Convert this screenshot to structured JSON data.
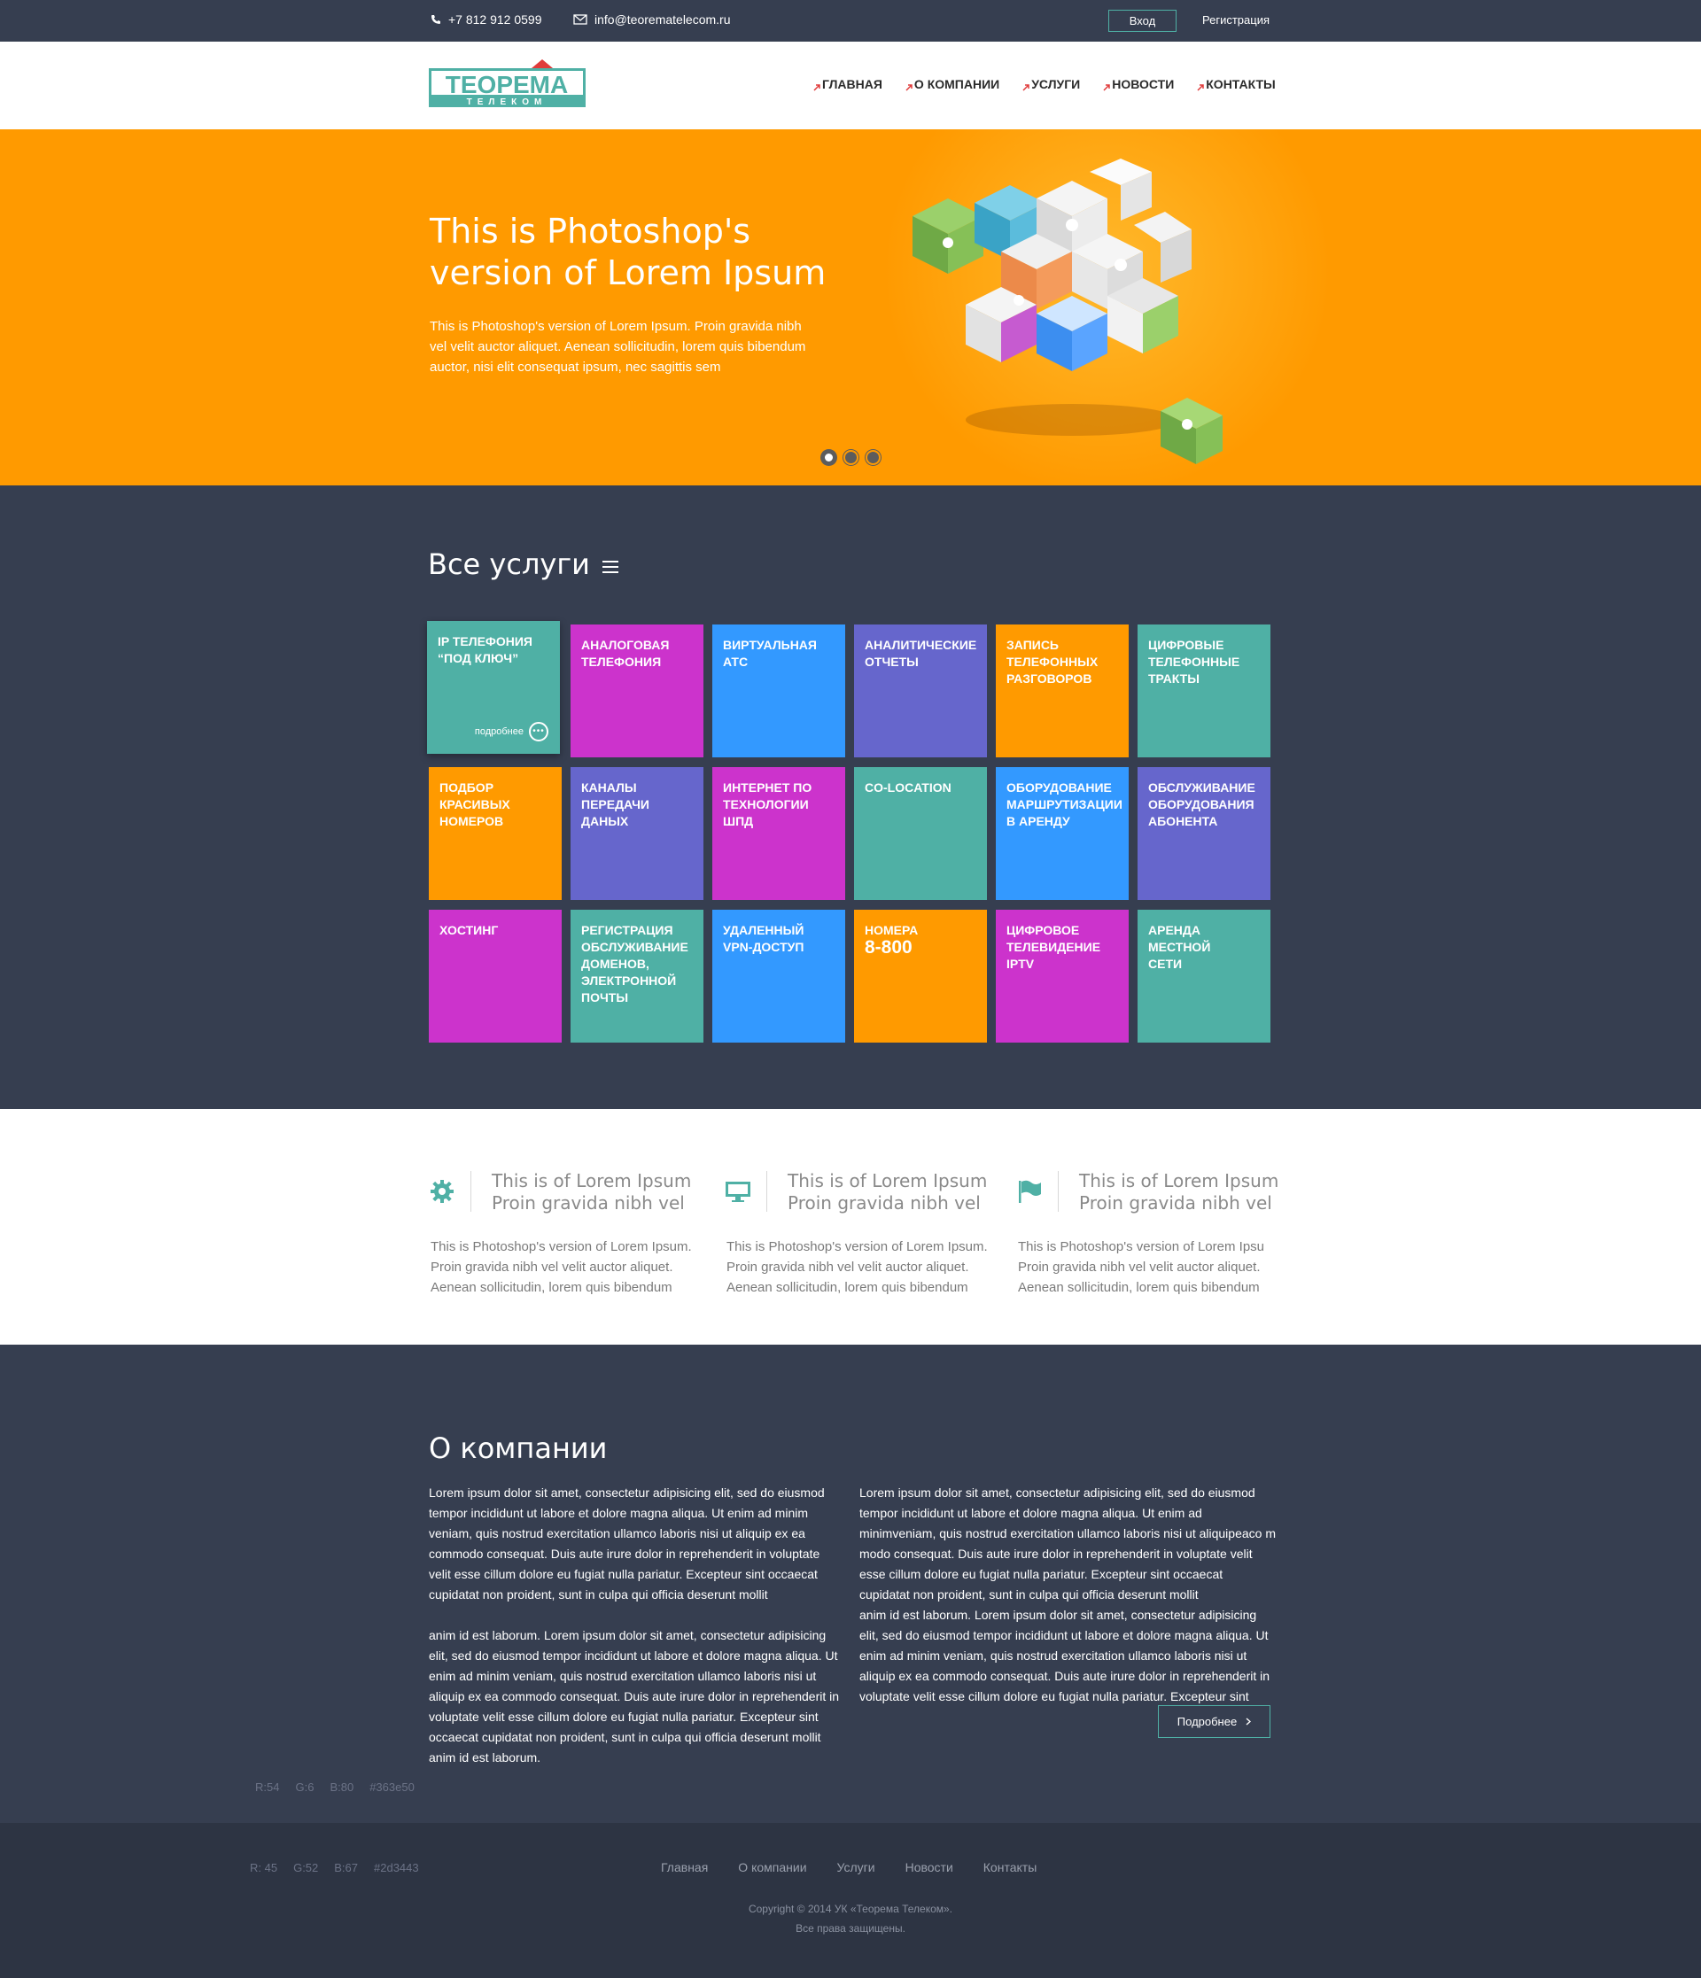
{
  "topbar": {
    "phone": "+7 812 912 0599",
    "email": "info@teorematelecom.ru",
    "login_label": "Вход",
    "register_label": "Регистрация"
  },
  "logo": {
    "line1": "ТЕОРЕМА",
    "line2": "ТЕЛЕКОМ"
  },
  "nav": [
    "ГЛАВНАЯ",
    "О КОМПАНИИ",
    "УСЛУГИ",
    "НОВОСТИ",
    "КОНТАКТЫ"
  ],
  "hero": {
    "title": "This is Photoshop's version  of Lorem Ipsum",
    "text": "This is Photoshop's version  of Lorem Ipsum. Proin gravida nibh vel velit auctor aliquet. Aenean sollicitudin, lorem quis bibendum auctor, nisi elit consequat ipsum, nec sagittis sem",
    "slides": 3,
    "active_slide": 1
  },
  "services": {
    "title": "Все услуги",
    "more_label": "подробнее",
    "tiles": [
      {
        "label": "IP ТЕЛЕФОНИЯ\n“ПОД КЛЮЧ”",
        "color": "#4fb0a5"
      },
      {
        "label": "АНАЛОГОВАЯ\nТЕЛЕФОНИЯ",
        "color": "#cc33cc"
      },
      {
        "label": "ВИРТУАЛЬНАЯ\nАТС",
        "color": "#3399ff"
      },
      {
        "label": "АНАЛИТИЧЕСКИЕ\nОТЧЕТЫ",
        "color": "#6666cc"
      },
      {
        "label": "ЗАПИСЬ\nТЕЛЕФОННЫХ\nРАЗГОВОРОВ",
        "color": "#ff9a00"
      },
      {
        "label": "ЦИФРОВЫЕ\nТЕЛЕФОННЫЕ\nТРАКТЫ",
        "color": "#4fb0a5"
      },
      {
        "label": "ПОДБОР\nКРАСИВЫХ\nНОМЕРОВ",
        "color": "#ff9a00"
      },
      {
        "label": "КАНАЛЫ\nПЕРЕДАЧИ\nДАНЫХ",
        "color": "#6666cc"
      },
      {
        "label": "ИНТЕРНЕТ ПО\nТЕХНОЛОГИИ ШПД",
        "color": "#cc33cc"
      },
      {
        "label": "CO-LOCATION",
        "color": "#4fb0a5"
      },
      {
        "label": "ОБОРУДОВАНИЕ\nМАРШРУТИЗАЦИИ\nВ АРЕНДУ",
        "color": "#3399ff"
      },
      {
        "label": "ОБСЛУЖИВАНИЕ\nОБОРУДОВАНИЯ\nАБОНЕНТА",
        "color": "#6666cc"
      },
      {
        "label": "ХОСТИНГ",
        "color": "#cc33cc"
      },
      {
        "label": "РЕГИСТРАЦИЯ\nОБСЛУЖИВАНИЕ\nДОМЕНОВ,\nЭЛЕКТРОННОЙ\nПОЧТЫ",
        "color": "#4fb0a5"
      },
      {
        "label": "УДАЛЕННЫЙ\nVPN-ДОСТУП",
        "color": "#3399ff"
      },
      {
        "label": "НОМЕРА",
        "big": "8-800",
        "color": "#ff9a00"
      },
      {
        "label": "ЦИФРОВОЕ\nТЕЛЕВИДЕНИЕ\nIPTV",
        "color": "#cc33cc"
      },
      {
        "label": "АРЕНДА\nМЕСТНОЙ\nСЕТИ",
        "color": "#4fb0a5"
      }
    ]
  },
  "features": [
    {
      "icon": "gear-icon",
      "title1": "This is of Lorem Ipsum",
      "title2": "Proin gravida nibh vel",
      "text": "This is Photoshop's version  of Lorem Ipsum. Proin gravida nibh vel velit auctor aliquet. Aenean sollicitudin, lorem quis bibendum"
    },
    {
      "icon": "monitor-icon",
      "title1": "This is of Lorem Ipsum",
      "title2": "Proin gravida nibh vel",
      "text": "This is Photoshop's version  of Lorem Ipsum. Proin gravida nibh vel velit auctor aliquet. Aenean sollicitudin, lorem quis bibendum"
    },
    {
      "icon": "flag-icon",
      "title1": "This is of Lorem Ipsum",
      "title2": "Proin gravida nibh vel",
      "text": "This is Photoshop's version  of Lorem Ipsu Proin gravida nibh vel velit auctor aliquet. Aenean sollicitudin, lorem quis bibendum"
    }
  ],
  "about": {
    "title": "О компании",
    "col1": "Lorem ipsum dolor sit amet, consectetur adipisicing elit, sed do eiusmod tempor incididunt ut labore et dolore magna aliqua. Ut enim ad minim veniam, quis nostrud exercitation ullamco laboris nisi ut aliquip ex ea commodo consequat. Duis aute irure dolor in reprehenderit in voluptate velit esse cillum dolore eu fugiat nulla pariatur. Excepteur sint occaecat cupidatat non proident, sunt in culpa qui officia deserunt mollit\n\nanim id est laborum. Lorem ipsum dolor sit amet, consectetur adipisicing elit, sed do eiusmod tempor incididunt ut labore et dolore magna aliqua. Ut enim ad minim veniam, quis nostrud exercitation ullamco laboris nisi ut aliquip ex ea commodo consequat. Duis aute irure dolor in reprehenderit in voluptate velit esse cillum dolore eu fugiat nulla pariatur. Excepteur sint occaecat cupidatat non proident, sunt in culpa qui officia deserunt mollit anim id est laborum.",
    "col2": "Lorem ipsum dolor sit amet, consectetur adipisicing elit, sed do eiusmod tempor incididunt ut labore et dolore magna aliqua. Ut enim ad minimveniam, quis nostrud exercitation ullamco laboris nisi ut aliquipeaco m modo consequat. Duis aute irure dolor in reprehenderit in voluptate velit esse cillum dolore eu fugiat nulla pariatur. Excepteur sint occaecat cupidatat non proident, sunt in culpa qui officia deserunt mollit\nanim id est laborum. Lorem ipsum dolor sit amet, consectetur adipisicing elit, sed do eiusmod tempor incididunt ut labore et dolore magna aliqua. Ut enim ad minim veniam, quis nostrud exercitation ullamco laboris nisi ut aliquip ex ea commodo consequat. Duis aute irure dolor in reprehenderit in voluptate velit esse cillum dolore eu fugiat nulla pariatur. Excepteur sint",
    "more_label": "Подробнее"
  },
  "swatches": {
    "main": {
      "r": "R:54",
      "g": "G:6",
      "b": "B:80",
      "hex": "#363e50"
    },
    "footer": {
      "r": "R: 45",
      "g": "G:52",
      "b": "B:67",
      "hex": "#2d3443"
    }
  },
  "footer": {
    "nav": [
      "Главная",
      "О компании",
      "Услуги",
      "Новости",
      "Контакты"
    ],
    "copyright": "Copyright © 2014 УК «Теорема Телеком».",
    "rights": "Все права защищены."
  },
  "colors": {
    "accent_teal": "#4fb0a5",
    "accent_orange": "#ff9a00",
    "dark_bg": "#363e50",
    "footer_bg": "#2d3443"
  }
}
